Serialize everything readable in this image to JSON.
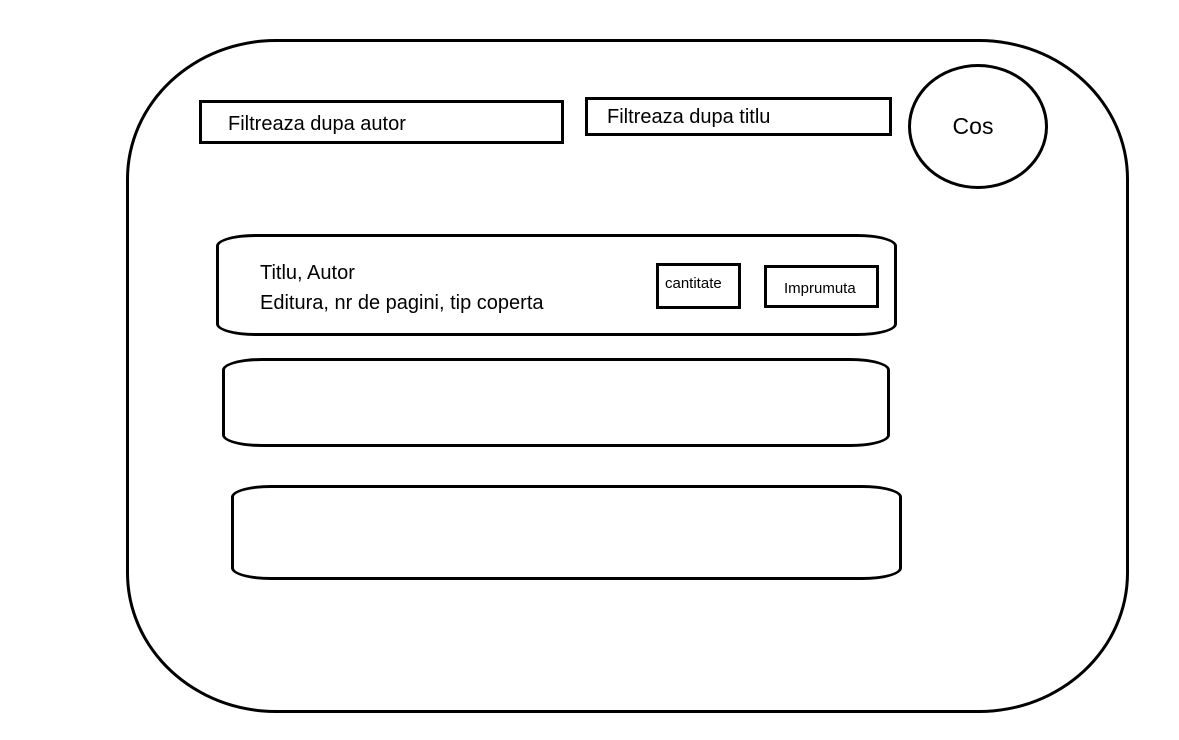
{
  "filters": {
    "author_placeholder": "Filtreaza dupa autor",
    "title_placeholder": "Filtreaza dupa titlu"
  },
  "cart": {
    "label": "Cos"
  },
  "book_list": {
    "items": [
      {
        "title_line": "Titlu, Autor",
        "details_line": "Editura, nr de pagini, tip coperta",
        "quantity_label": "cantitate",
        "borrow_label": "Imprumuta"
      }
    ]
  }
}
